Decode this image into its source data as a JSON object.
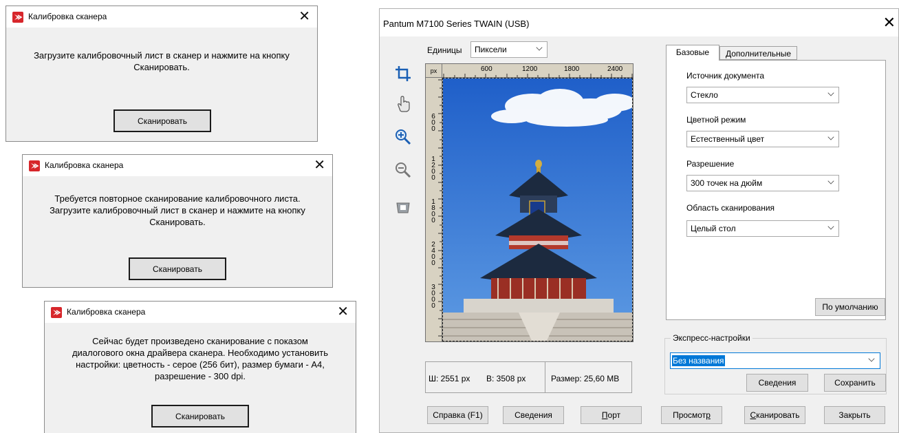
{
  "dialogs": [
    {
      "title": "Калибровка сканера",
      "message_lines": [
        "Загрузите калибровочный лист в сканер и нажмите на кнопку",
        "Сканировать."
      ],
      "button": "Сканировать"
    },
    {
      "title": "Калибровка сканера",
      "message_lines": [
        "Требуется повторное сканирование калибровочного листа.",
        "Загрузите калибровочный лист в сканер и нажмите на кнопку",
        "Сканировать."
      ],
      "button": "Сканировать"
    },
    {
      "title": "Калибровка сканера",
      "message_lines": [
        "Сейчас будет произведено сканирование с показом",
        "диалогового окна драйвера сканера. Необходимо установить",
        "настройки: цветность - серое (256 бит), размер бумаги - А4,",
        "разрешение - 300 dpi."
      ],
      "button": "Сканировать"
    }
  ],
  "twain": {
    "title": "Pantum M7100 Series TWAIN (USB)",
    "units_label": "Единицы",
    "units_value": "Пиксели",
    "ruler": {
      "unit": "px",
      "h_ticks": [
        "600",
        "1200",
        "1800",
        "2400"
      ],
      "v_ticks": [
        "600",
        "1200",
        "1800",
        "2400",
        "3000"
      ]
    },
    "info": {
      "width": "Ш: 2551 px",
      "height": "В: 3508 px",
      "size": "Размер: 25,60 MB"
    },
    "tabs": {
      "basic": "Базовые",
      "advanced": "Дополнительные"
    },
    "fields": {
      "source_label": "Источник документа",
      "source_value": "Стекло",
      "color_label": "Цветной режим",
      "color_value": "Естественный цвет",
      "resolution_label": "Разрешение",
      "resolution_value": "300 точек на дюйм",
      "area_label": "Область сканирования",
      "area_value": "Целый стол"
    },
    "default_button": "По умолчанию",
    "express": {
      "legend": "Экспресс-настройки",
      "value": "Без названия",
      "info_button": "Сведения",
      "save_button": "Сохранить"
    },
    "bottom_buttons": {
      "help": "Справка (F1)",
      "info": "Сведения",
      "port_u": "П",
      "port_rest": "орт",
      "preview_pre": "Просмот",
      "preview_u": "р",
      "scan_u": "С",
      "scan_rest": "канировать",
      "close": "Закрыть"
    }
  }
}
